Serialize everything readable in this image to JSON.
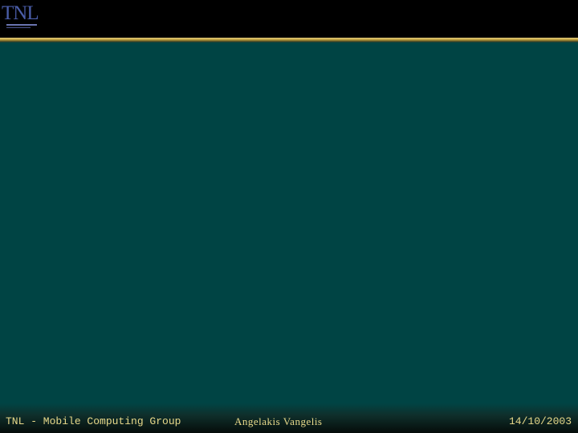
{
  "header": {
    "logo": {
      "text": "TNL",
      "icon": "tnl-logo-icon"
    }
  },
  "footer": {
    "group": "TNL - Mobile Computing Group",
    "author": "Angelakis Vangelis",
    "date": "14/10/2003"
  },
  "colors": {
    "background": "#004444",
    "header": "#000000",
    "accent_rule": "#d8bf6a",
    "footer_text": "#e8d98a",
    "logo": "#4a5da8"
  }
}
